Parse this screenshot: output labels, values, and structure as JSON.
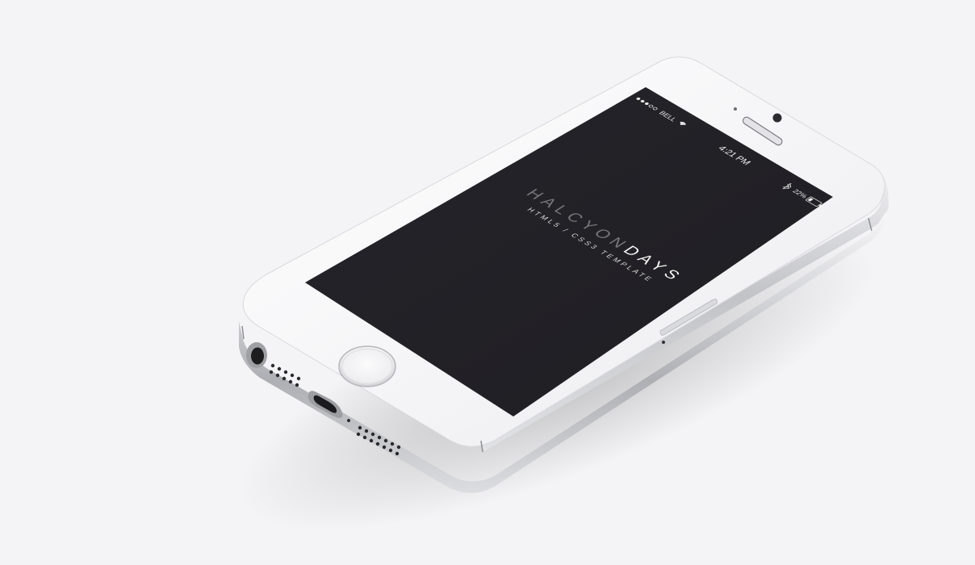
{
  "status_bar": {
    "carrier": "BELL",
    "time": "4:21 PM",
    "battery": "22%"
  },
  "screen": {
    "title_light": "HALCYON",
    "title_bold": "DAYS",
    "subtitle": "HTML5 / CSS3 TEMPLATE"
  },
  "colors": {
    "background": "#f4f4f6",
    "screen": "#222126",
    "device_body": "#f5f5f7",
    "title_light": "#77767b",
    "title_bold": "#f2f2f2"
  },
  "icons": {
    "signal": "signal-dots-icon",
    "wifi": "wifi-icon",
    "bluetooth": "bluetooth-icon",
    "battery": "battery-icon",
    "camera": "front-camera-icon",
    "speaker": "earpiece-speaker-icon",
    "home": "home-button-icon",
    "headphone": "headphone-jack-icon",
    "lightning": "lightning-port-icon"
  }
}
